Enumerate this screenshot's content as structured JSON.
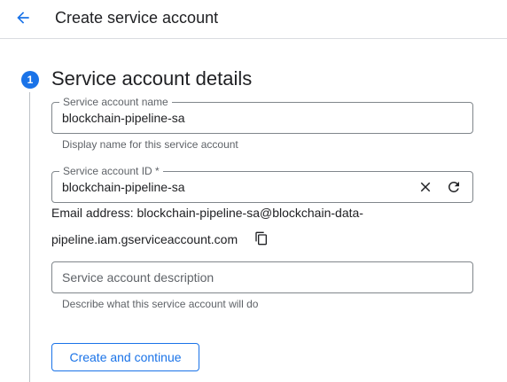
{
  "header": {
    "title": "Create service account",
    "back_icon": "arrow-back-icon"
  },
  "step": {
    "number": "1",
    "title": "Service account details"
  },
  "fields": {
    "name": {
      "label": "Service account name",
      "value": "blockchain-pipeline-sa",
      "hint": "Display name for this service account"
    },
    "id": {
      "label": "Service account ID *",
      "value": "blockchain-pipeline-sa",
      "clear_icon": "close-icon",
      "refresh_icon": "refresh-icon"
    },
    "email": {
      "line1": "Email address: blockchain-pipeline-sa@blockchain-data-",
      "line2": "pipeline.iam.gserviceaccount.com",
      "copy_icon": "copy-icon"
    },
    "description": {
      "placeholder": "Service account description",
      "value": "",
      "hint": "Describe what this service account will do"
    }
  },
  "actions": {
    "create_label": "Create and continue"
  },
  "colors": {
    "accent": "#1a73e8",
    "text": "#202124",
    "secondary_text": "#5f6368",
    "border": "#80868b"
  }
}
